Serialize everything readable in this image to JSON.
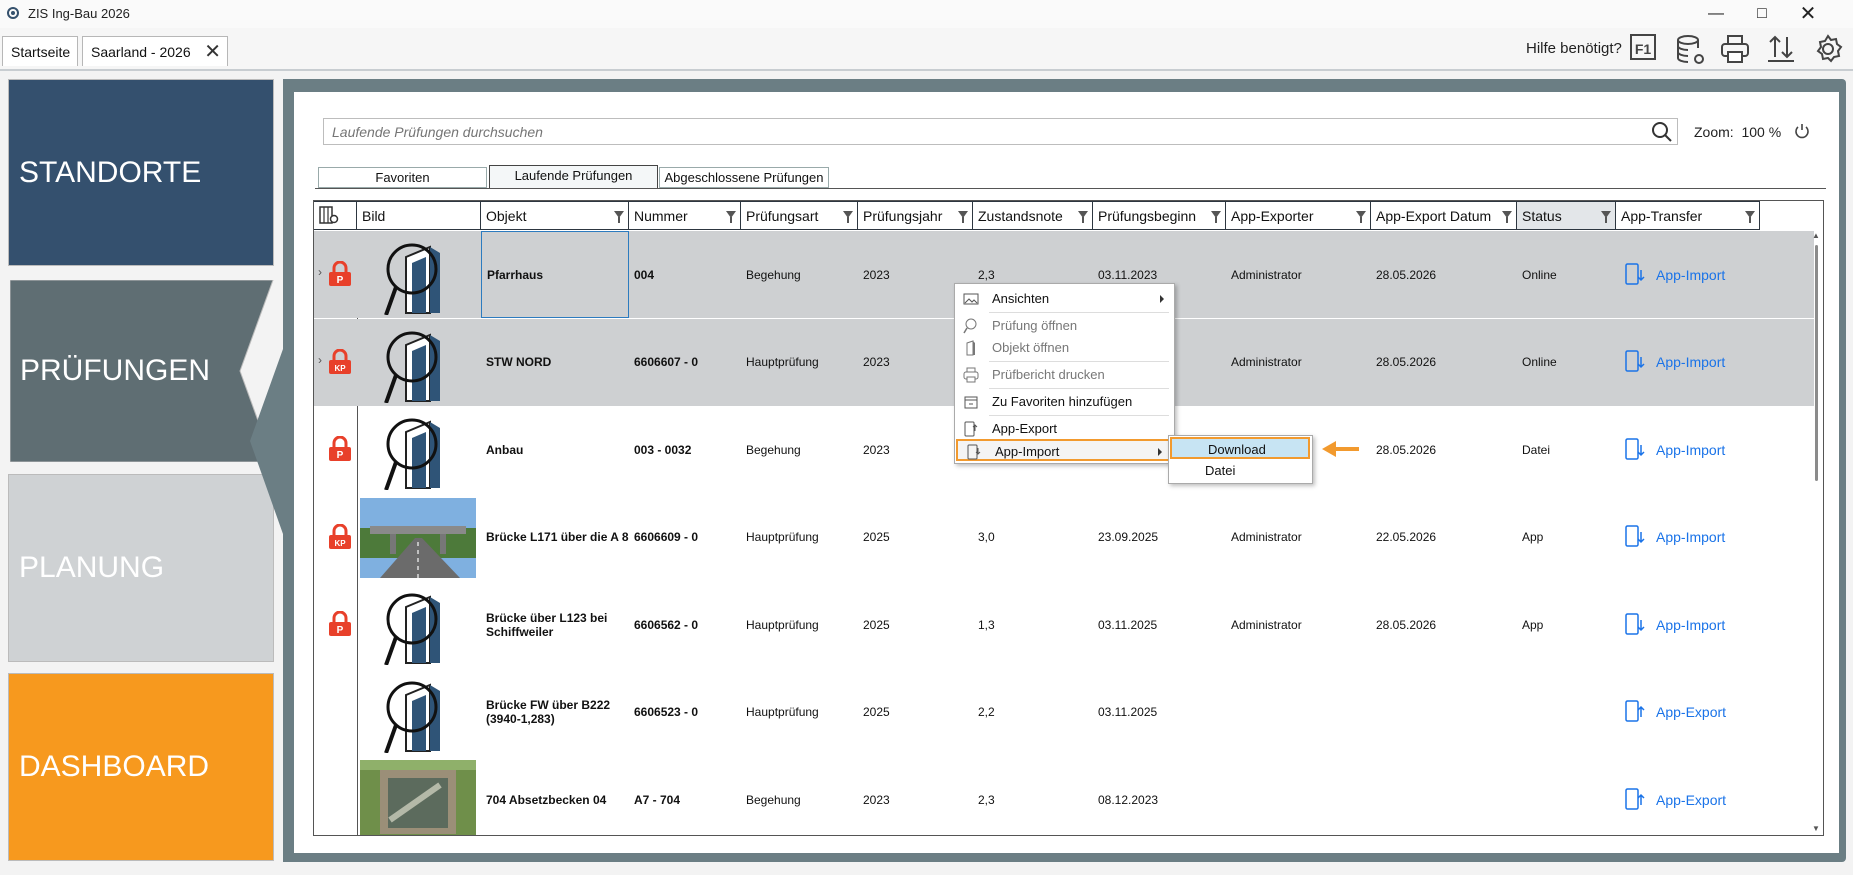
{
  "window": {
    "title": "ZIS Ing-Bau 2026"
  },
  "tabs": [
    {
      "label": "Startseite"
    },
    {
      "label": "Saarland - 2026"
    }
  ],
  "toolbar": {
    "help_text": "Hilfe benötigt?",
    "f1_label": "F1"
  },
  "nav": {
    "standorte": "STANDORTE",
    "pruefungen": "PRÜFUNGEN",
    "planung": "PLANUNG",
    "dashboard": "DASHBOARD"
  },
  "search": {
    "placeholder": "Laufende Prüfungen durchsuchen",
    "zoom_label": "Zoom:",
    "zoom_value": "100 %"
  },
  "subtabs": [
    {
      "label": "Favoriten"
    },
    {
      "label": "Laufende Prüfungen"
    },
    {
      "label": "Abgeschlossene Prüfungen"
    }
  ],
  "columns": [
    "Bild",
    "Objekt",
    "Nummer",
    "Prüfungsart",
    "Prüfungsjahr",
    "Zustandsnote",
    "Prüfungsbeginn",
    "App-Exporter",
    "App-Export Datum",
    "Status",
    "App-Transfer"
  ],
  "rows": [
    {
      "badge": "P",
      "objekt": "Pfarrhaus",
      "nummer": "004",
      "art": "Begehung",
      "jahr": "2023",
      "note": "2,3",
      "beginn": "03.11.2023",
      "exporter": "Administrator",
      "datum": "28.05.2026",
      "status": "Online",
      "transfer": "App-Import",
      "image": "building"
    },
    {
      "badge": "KP",
      "objekt": "STW NORD",
      "nummer": "6606607 - 0",
      "art": "Hauptprüfung",
      "jahr": "2023",
      "note": "",
      "beginn": "",
      "exporter": "Administrator",
      "datum": "28.05.2026",
      "status": "Online",
      "transfer": "App-Import",
      "image": "building"
    },
    {
      "badge": "P",
      "objekt": "Anbau",
      "nummer": "003 - 0032",
      "art": "Begehung",
      "jahr": "2023",
      "note": "",
      "beginn": "",
      "exporter": "",
      "datum": "28.05.2026",
      "status": "Datei",
      "transfer": "App-Import",
      "image": "building"
    },
    {
      "badge": "KP",
      "objekt": "Brücke L171 über die A 8",
      "nummer": "6606609 - 0",
      "art": "Hauptprüfung",
      "jahr": "2025",
      "note": "3,0",
      "beginn": "23.09.2025",
      "exporter": "Administrator",
      "datum": "22.05.2026",
      "status": "App",
      "transfer": "App-Import",
      "image": "bridge"
    },
    {
      "badge": "P",
      "objekt": "Brücke über L123 bei Schiffweiler",
      "nummer": "6606562 - 0",
      "art": "Hauptprüfung",
      "jahr": "2025",
      "note": "1,3",
      "beginn": "03.11.2025",
      "exporter": "Administrator",
      "datum": "28.05.2026",
      "status": "App",
      "transfer": "App-Import",
      "image": "building"
    },
    {
      "badge": "",
      "objekt": "Brücke FW über B222 (3940-1,283)",
      "nummer": "6606523 - 0",
      "art": "Hauptprüfung",
      "jahr": "2025",
      "note": "2,2",
      "beginn": "03.11.2025",
      "exporter": "",
      "datum": "",
      "status": "",
      "transfer": "App-Export",
      "image": "building"
    },
    {
      "badge": "",
      "objekt": "704 Absetzbecken 04",
      "nummer": "A7 - 704",
      "art": "Begehung",
      "jahr": "2023",
      "note": "2,3",
      "beginn": "08.12.2023",
      "exporter": "",
      "datum": "",
      "status": "",
      "transfer": "App-Export",
      "image": "basin"
    }
  ],
  "context_menu": {
    "items": [
      {
        "label": "Ansichten"
      },
      {
        "label": "Prüfung öffnen"
      },
      {
        "label": "Objekt öffnen"
      },
      {
        "label": "Prüfbericht drucken"
      },
      {
        "label": "Zu Favoriten hinzufügen"
      },
      {
        "label": "App-Export"
      },
      {
        "label": "App-Import"
      }
    ],
    "submenu": [
      {
        "label": "Download"
      },
      {
        "label": "Datei"
      }
    ]
  },
  "colors": {
    "accent": "#f29a2e",
    "link": "#1a73e8",
    "badge_red": "#e8402a",
    "nav_blue": "#34506e",
    "nav_grey": "#5f6e73",
    "nav_orange": "#f7991e"
  }
}
